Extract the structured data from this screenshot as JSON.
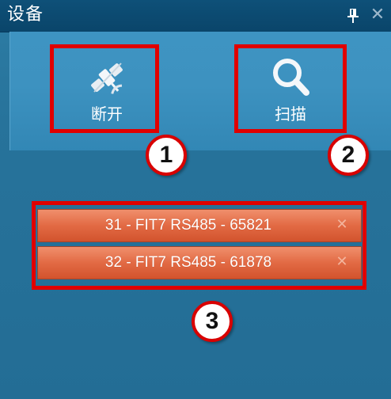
{
  "panel": {
    "title": "设备",
    "pin_icon": "pin-icon",
    "close_glyph": "✕",
    "close_icon": "close-icon"
  },
  "toolbar": {
    "buttons": [
      {
        "label": "断开",
        "icon": "disconnect-satellite-icon"
      },
      {
        "label": "扫描",
        "icon": "search-icon"
      }
    ]
  },
  "devices": [
    {
      "label": "31 - FIT7 RS485 - 65821",
      "remove_glyph": "✕",
      "remove_icon": "remove-icon"
    },
    {
      "label": "32 - FIT7 RS485 - 61878",
      "remove_glyph": "✕",
      "remove_icon": "remove-icon"
    }
  ],
  "annotations": {
    "markers": [
      "1",
      "2",
      "3"
    ],
    "color": "#e00000"
  },
  "colors": {
    "panel_bg": "#27739b",
    "titlebar_bg": "#0e5078",
    "toolbar_bg": "#3d92c0",
    "device_bg": "#e26a44"
  }
}
